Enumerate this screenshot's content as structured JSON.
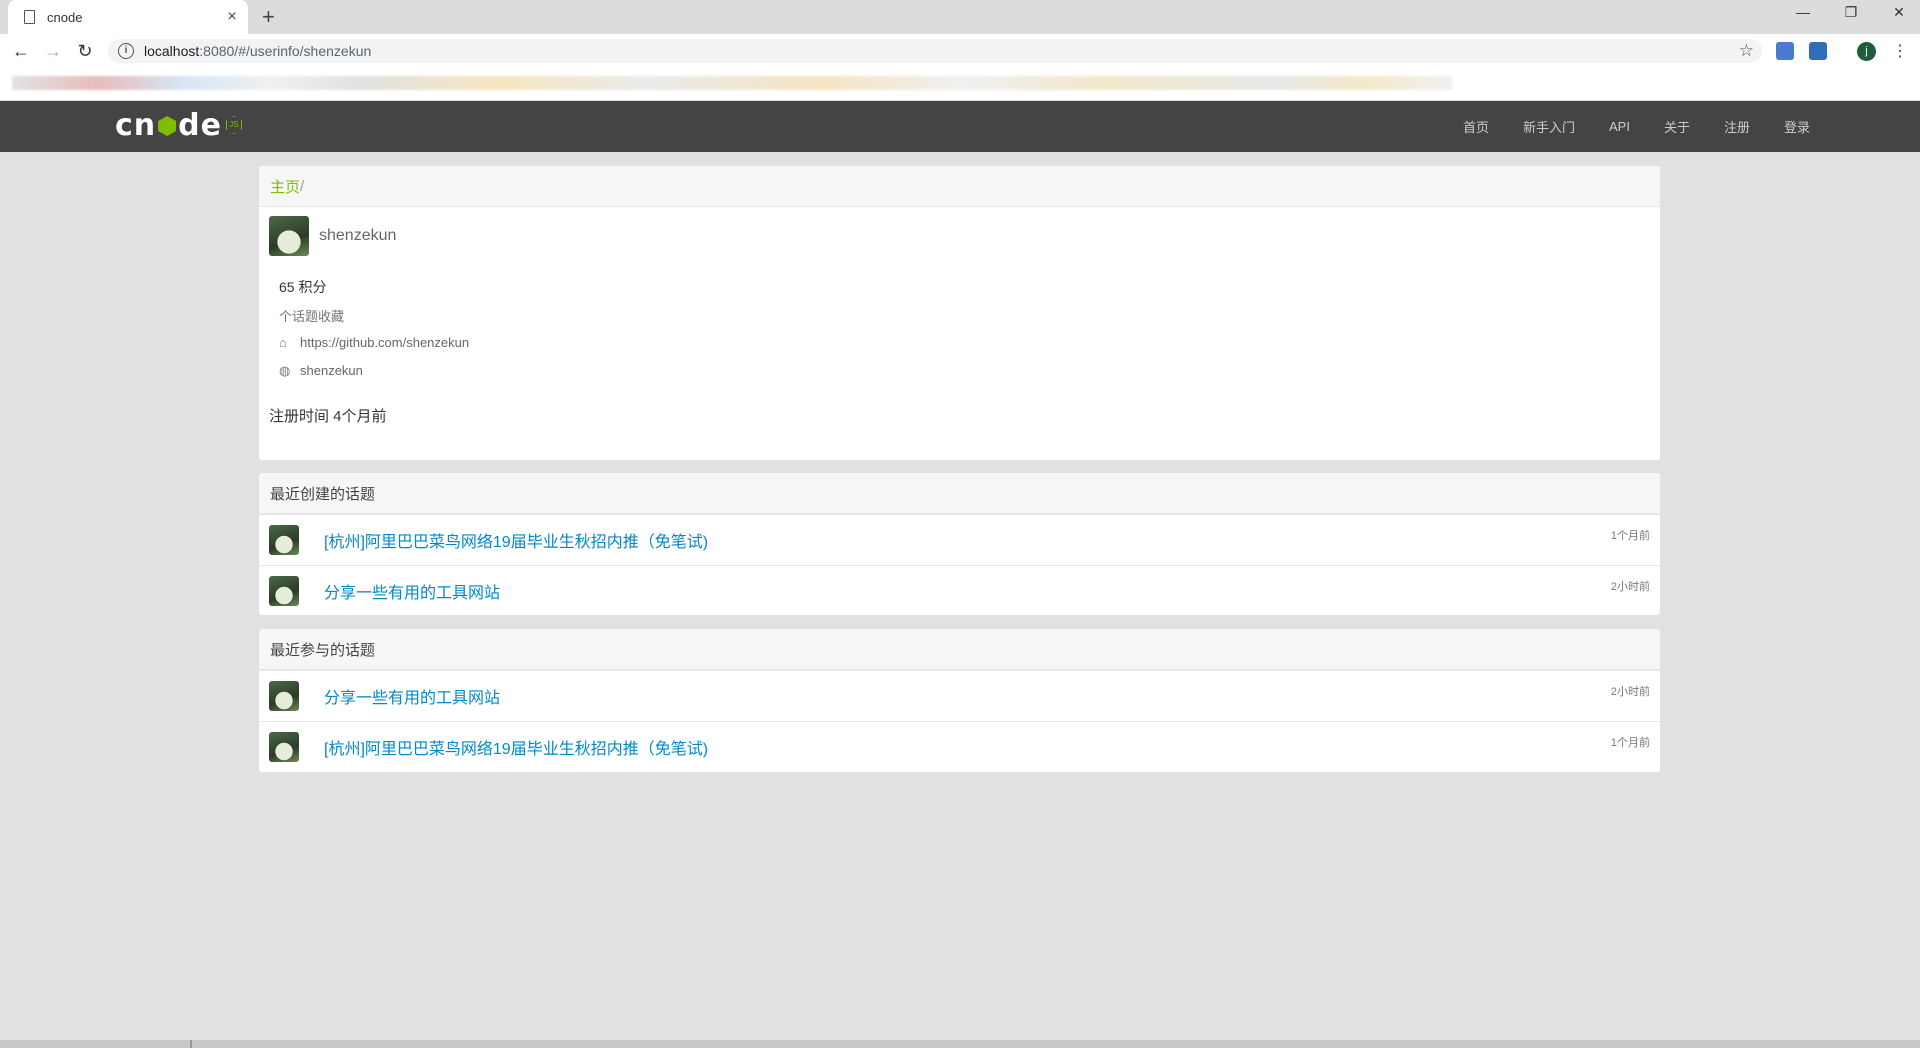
{
  "browser": {
    "tab_title": "cnode",
    "tab_close": "×",
    "new_tab": "+",
    "url_host": "localhost",
    "url_path": ":8080/#/userinfo/shenzekun",
    "profile_initial": "j",
    "window_controls": [
      "—",
      "❐",
      "✕"
    ]
  },
  "navbar": {
    "brand": "cnode",
    "links": [
      "首页",
      "新手入门",
      "API",
      "关于",
      "注册",
      "登录"
    ],
    "accent_color": "#80bd01"
  },
  "profile": {
    "breadcrumb_home": "主页",
    "breadcrumb_sep": "/",
    "username": "shenzekun",
    "score": "65 积分",
    "collect": "个话题收藏",
    "homepage": "https://github.com/shenzekun",
    "github": "shenzekun",
    "register_time": "注册时间 4个月前"
  },
  "recent_created": {
    "header": "最近创建的话题",
    "topics": [
      {
        "title": "[杭州]阿里巴巴菜鸟网络19届毕业生秋招内推（免笔试)",
        "time": "1个月前"
      },
      {
        "title": "分享一些有用的工具网站",
        "time": "2小时前"
      }
    ]
  },
  "recent_replied": {
    "header": "最近参与的话题",
    "topics": [
      {
        "title": "分享一些有用的工具网站",
        "time": "2小时前"
      },
      {
        "title": "[杭州]阿里巴巴菜鸟网络19届毕业生秋招内推（免笔试)",
        "time": "1个月前"
      }
    ]
  }
}
